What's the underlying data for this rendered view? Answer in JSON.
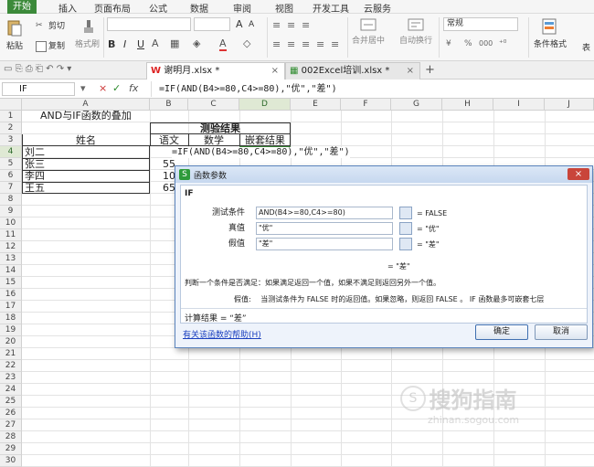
{
  "menu": [
    "开始",
    "插入",
    "页面布局",
    "公式",
    "数据",
    "审阅",
    "视图",
    "开发工具",
    "云服务"
  ],
  "ribbon": {
    "paste_label": "粘贴",
    "cut_label": "剪切",
    "copy_label": "复制",
    "format_painter_label": "格式刷",
    "merge_center_label": "合并居中",
    "wrap_label": "自动换行",
    "number_format_value": "常规",
    "percent_label": "%",
    "thousands_label": "000",
    "conditional_format_label": "条件格式",
    "table_label": "表",
    "bold": "B",
    "italic": "I",
    "underline": "U",
    "grow_font": "A",
    "shrink_font": "A"
  },
  "doc_tabs": [
    {
      "label": "谢明月.xlsx *",
      "active": true
    },
    {
      "label": "002Excel培训.xlsx *",
      "active": false
    }
  ],
  "formula_bar": {
    "name_box": "IF",
    "fx": "fx",
    "formula": "=IF(AND(B4>=80,C4>=80),\"优\",\"差\")"
  },
  "columns": [
    "A",
    "B",
    "C",
    "D",
    "E",
    "F",
    "G",
    "H",
    "I",
    "J"
  ],
  "rows": [
    "1",
    "2",
    "3",
    "4",
    "5",
    "6",
    "7",
    "8",
    "9",
    "10",
    "11",
    "12",
    "13",
    "14",
    "15",
    "16",
    "17",
    "18",
    "19",
    "20",
    "21",
    "22",
    "23",
    "24",
    "25",
    "26",
    "27",
    "28",
    "29",
    "30"
  ],
  "sheet": {
    "a1": "AND与IF函数的叠加",
    "b2": "测验结果",
    "a3": "姓名",
    "b3": "语文",
    "c3": "数学",
    "d3": "嵌套结果",
    "names": [
      "刘二",
      "张三",
      "李四",
      "王五"
    ],
    "b_vals": [
      "55",
      "100",
      "65"
    ],
    "edit_formula": "=IF(AND(B4>=80,C4>=80),\"优\",\"差\")"
  },
  "dialog": {
    "title": "函数参数",
    "func_name": "IF",
    "args": [
      {
        "label": "测试条件",
        "value": "AND(B4>=80,C4>=80)",
        "result": "= FALSE"
      },
      {
        "label": "真值",
        "value": "\"优\"",
        "result": "= \"优\""
      },
      {
        "label": "假值",
        "value": "\"差\"",
        "result": "= \"差\""
      }
    ],
    "overall_result": "= \"差\"",
    "description": "判断一个条件是否满足：如果满足返回一个值，如果不满足则返回另外一个值。",
    "arg_help_label": "假值:",
    "arg_help_text": "当测试条件为 FALSE 时的返回值。如果忽略，则返回 FALSE 。 IF 函数最多可嵌套七层",
    "calc_result": "计算结果 = “差”",
    "help_link": "有关该函数的帮助(H)",
    "ok_label": "确定",
    "cancel_label": "取消"
  },
  "watermark": {
    "text": "搜狗指南",
    "sub": "zhinan.sogou.com"
  },
  "colors": {
    "accent": "#3c8a3a",
    "dialog_border": "#5b84bd",
    "link": "#1a3fbf"
  }
}
